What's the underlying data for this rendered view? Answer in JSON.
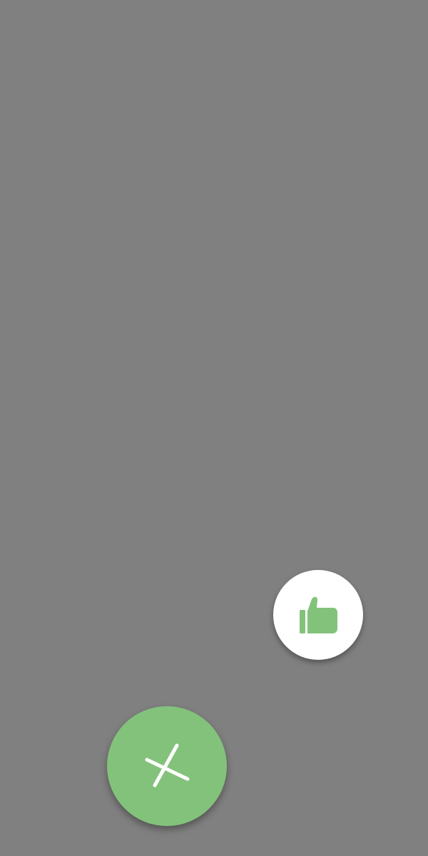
{
  "screen": {
    "background": "#808080"
  },
  "fab_menu": {
    "main_button": {
      "icon": "close-icon",
      "color": "#83c27b",
      "icon_color": "#ffffff"
    },
    "actions": [
      {
        "icon": "thumbs-up-icon",
        "background": "#ffffff",
        "icon_color": "#83c27b"
      }
    ]
  }
}
